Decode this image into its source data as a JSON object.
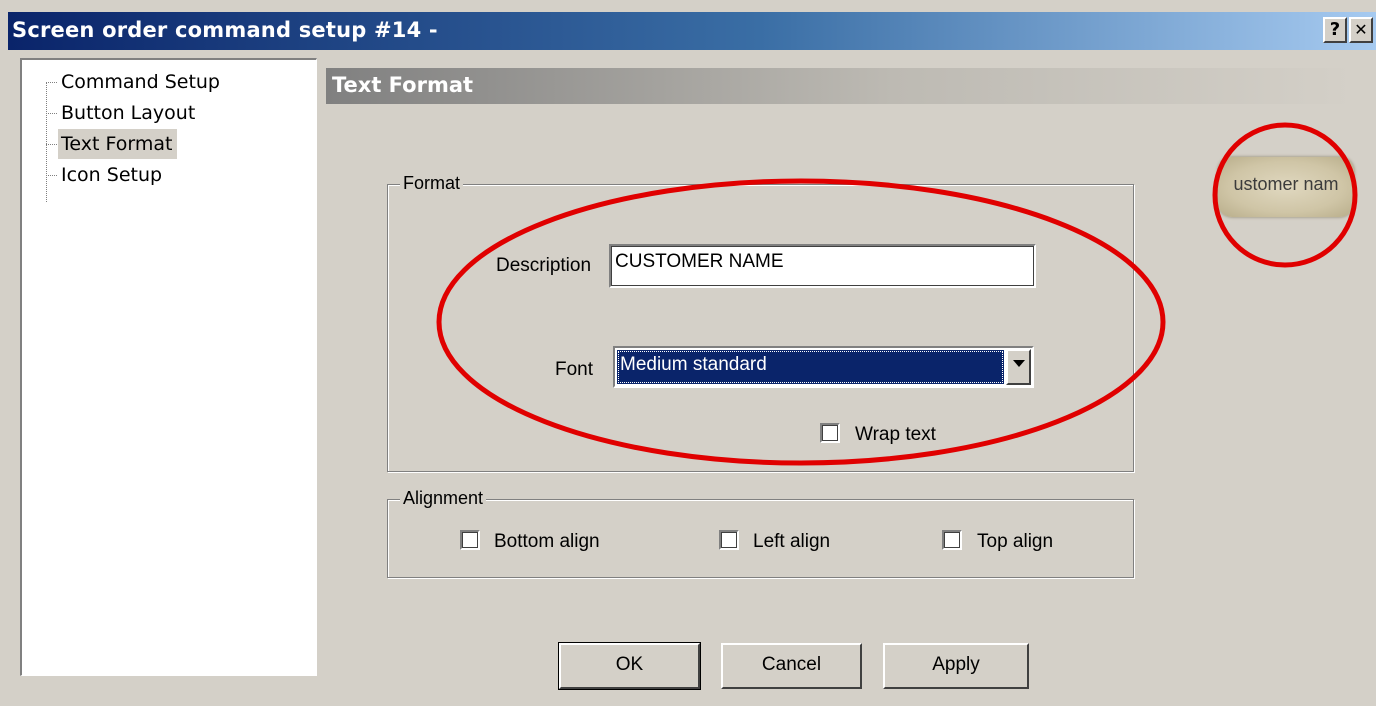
{
  "window": {
    "title": "Screen order command setup #14 -",
    "help_button": "?",
    "close_button": "✕"
  },
  "tree": {
    "items": [
      {
        "label": "Command Setup"
      },
      {
        "label": "Button Layout"
      },
      {
        "label": "Text Format",
        "selected": true
      },
      {
        "label": "Icon Setup"
      }
    ]
  },
  "section": {
    "title": "Text Format"
  },
  "format_group": {
    "legend": "Format",
    "description_label": "Description",
    "description_value": "CUSTOMER NAME",
    "font_label": "Font",
    "font_value": "Medium standard",
    "wrap_text_label": "Wrap text",
    "wrap_text_checked": false
  },
  "alignment_group": {
    "legend": "Alignment",
    "options": [
      {
        "label": "Bottom align",
        "checked": false
      },
      {
        "label": "Left align",
        "checked": false
      },
      {
        "label": "Top align",
        "checked": false
      }
    ]
  },
  "preview": {
    "text": "ustomer nam"
  },
  "buttons": {
    "ok": "OK",
    "cancel": "Cancel",
    "apply": "Apply"
  },
  "colors": {
    "titlebar_start": "#0a246a",
    "dialog_face": "#d4d0c8",
    "selection": "#0a246a",
    "annotation": "#e00000"
  }
}
